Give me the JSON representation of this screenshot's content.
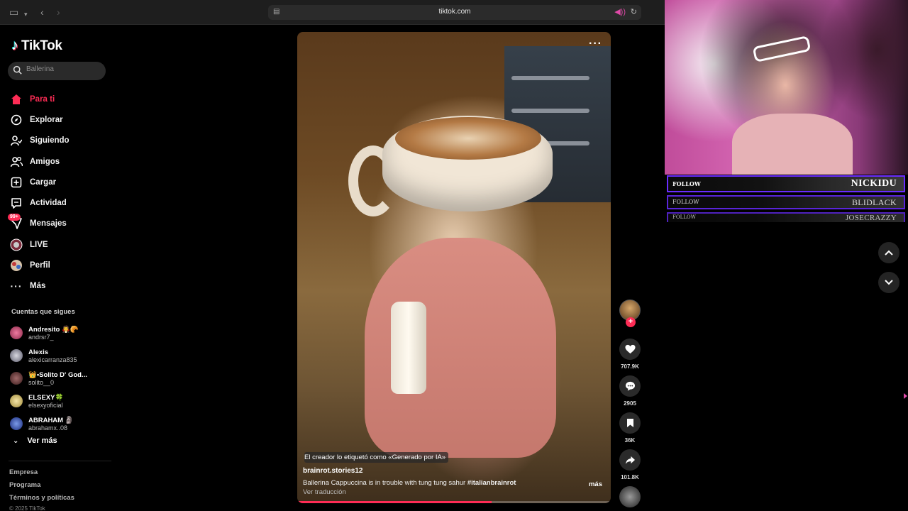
{
  "browser": {
    "url": "tiktok.com"
  },
  "sidebar": {
    "brand": "TikTok",
    "search_placeholder": "Ballerina",
    "nav": [
      {
        "label": "Para ti",
        "icon": "home-icon",
        "active": true
      },
      {
        "label": "Explorar",
        "icon": "compass-icon"
      },
      {
        "label": "Siguiendo",
        "icon": "following-icon"
      },
      {
        "label": "Amigos",
        "icon": "friends-icon"
      },
      {
        "label": "Cargar",
        "icon": "upload-icon"
      },
      {
        "label": "Actividad",
        "icon": "activity-icon"
      },
      {
        "label": "Mensajes",
        "icon": "messages-icon",
        "badge": "99+"
      },
      {
        "label": "LIVE",
        "icon": "live-icon"
      },
      {
        "label": "Perfil",
        "icon": "profile-icon"
      },
      {
        "label": "Más",
        "icon": "more-icon"
      }
    ],
    "following_title": "Cuentas que sigues",
    "accounts": [
      {
        "name": "Andresito 🧛🥐",
        "handle": "andrsr7_",
        "color": "#c23a6a"
      },
      {
        "name": "Alexis",
        "handle": "alexicarranza835",
        "color": "#8a8a9a"
      },
      {
        "name": "👑•Solito D' God...",
        "handle": "solito__0",
        "color": "#6a3a3a"
      },
      {
        "name": "ELSEXY🍀",
        "handle": "elsexyoficial",
        "color": "#d9c27a"
      },
      {
        "name": "ABRAHAM 🗿",
        "handle": "abrahamx..08",
        "color": "#3a5ac2"
      }
    ],
    "see_more": "Ver más",
    "footer": [
      "Empresa",
      "Programa",
      "Términos y políticas"
    ],
    "copyright": "© 2025 TikTok"
  },
  "video": {
    "ai_label": "El creador lo etiquetó como «Generado por IA»",
    "author": "brainrot.stories12",
    "caption": "Ballerina Cappuccina is in trouble with tung tung sahur",
    "hashtag": "#italianbrainrot",
    "translate": "Ver traducción",
    "more": "más",
    "progress": 0.62
  },
  "actions": {
    "likes": "707.9K",
    "comments": "2905",
    "saves": "36K",
    "shares": "101.8K"
  },
  "stream_alerts": [
    {
      "label": "FOLLOW",
      "name": "NICKIDU"
    },
    {
      "label": "FOLLOW",
      "name": "BLIDLACK"
    },
    {
      "label": "FOLLOW",
      "name": "JOSECRAZZY"
    }
  ],
  "colors": {
    "accent": "#fe2c55",
    "alert_border": "#6a2cff"
  }
}
